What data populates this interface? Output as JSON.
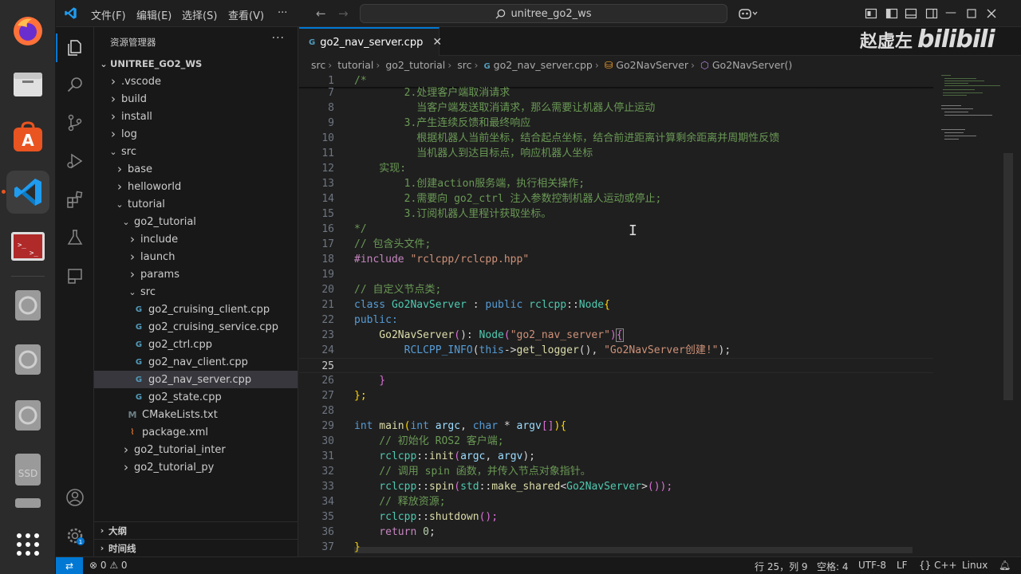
{
  "titlebar": {
    "menus": [
      "文件(F)",
      "编辑(E)",
      "选择(S)",
      "查看(V)",
      "···"
    ],
    "search_text": "unitree_go2_ws"
  },
  "explorer": {
    "title": "资源管理器",
    "root": "UNITREE_GO2_WS",
    "items": [
      {
        "label": ".vscode",
        "depth": 1,
        "kind": "folder-closed"
      },
      {
        "label": "build",
        "depth": 1,
        "kind": "folder-closed"
      },
      {
        "label": "install",
        "depth": 1,
        "kind": "folder-closed"
      },
      {
        "label": "log",
        "depth": 1,
        "kind": "folder-closed"
      },
      {
        "label": "src",
        "depth": 1,
        "kind": "folder-open"
      },
      {
        "label": "base",
        "depth": 2,
        "kind": "folder-closed"
      },
      {
        "label": "helloworld",
        "depth": 2,
        "kind": "folder-closed"
      },
      {
        "label": "tutorial",
        "depth": 2,
        "kind": "folder-open"
      },
      {
        "label": "go2_tutorial",
        "depth": 3,
        "kind": "folder-open"
      },
      {
        "label": "include",
        "depth": 4,
        "kind": "folder-closed"
      },
      {
        "label": "launch",
        "depth": 4,
        "kind": "folder-closed"
      },
      {
        "label": "params",
        "depth": 4,
        "kind": "folder-closed"
      },
      {
        "label": "src",
        "depth": 4,
        "kind": "folder-open"
      },
      {
        "label": "go2_cruising_client.cpp",
        "depth": 5,
        "kind": "cpp"
      },
      {
        "label": "go2_cruising_service.cpp",
        "depth": 5,
        "kind": "cpp"
      },
      {
        "label": "go2_ctrl.cpp",
        "depth": 5,
        "kind": "cpp"
      },
      {
        "label": "go2_nav_client.cpp",
        "depth": 5,
        "kind": "cpp"
      },
      {
        "label": "go2_nav_server.cpp",
        "depth": 5,
        "kind": "cpp",
        "selected": true
      },
      {
        "label": "go2_state.cpp",
        "depth": 5,
        "kind": "cpp"
      },
      {
        "label": "CMakeLists.txt",
        "depth": 4,
        "kind": "cmake"
      },
      {
        "label": "package.xml",
        "depth": 4,
        "kind": "xml"
      },
      {
        "label": "go2_tutorial_inter",
        "depth": 3,
        "kind": "folder-closed"
      },
      {
        "label": "go2_tutorial_py",
        "depth": 3,
        "kind": "folder-closed"
      }
    ],
    "outline": "大纲",
    "timeline": "时间线"
  },
  "editor": {
    "tab_label": "go2_nav_server.cpp",
    "breadcrumbs": [
      "src",
      "tutorial",
      "go2_tutorial",
      "src",
      "go2_nav_server.cpp",
      "Go2NavServer",
      "Go2NavServer()"
    ],
    "cursor_line": 25
  },
  "code": {
    "l1": "1",
    "t1": "/*",
    "l7": "7",
    "t7": "        2.处理客户端取消请求",
    "l8": "8",
    "t8": "          当客户端发送取消请求，那么需要让机器人停止运动",
    "l9": "9",
    "t9": "        3.产生连续反馈和最终响应",
    "l10": "10",
    "t10": "          根据机器人当前坐标，结合起点坐标，结合前进距离计算剩余距离并周期性反馈",
    "l11": "11",
    "t11": "          当机器人到达目标点，响应机器人坐标",
    "l12": "12",
    "t12": "    实现:",
    "l13": "13",
    "t13": "        1.创建action服务端，执行相关操作;",
    "l14": "14",
    "t14": "        2.需要向 go2_ctrl 注入参数控制机器人运动或停止;",
    "l15": "15",
    "t15": "        3.订阅机器人里程计获取坐标。",
    "l16": "16",
    "t16": "*/",
    "l17": "17",
    "t17": "// 包含头文件;",
    "l18": "18",
    "t18a": "#include",
    "t18b": " \"rclcpp/rclcpp.hpp\"",
    "l19": "19",
    "l20": "20",
    "t20": "// 自定义节点类;",
    "l21": "21",
    "t21a": "class",
    "t21b": " Go2NavServer",
    "t21c": " : ",
    "t21d": "public",
    "t21e": " rclcpp",
    "t21f": "::",
    "t21g": "Node",
    "t21h": "{",
    "l22": "22",
    "t22": "public:",
    "l23": "23",
    "t23a": "    Go2NavServer",
    "t23b": "(",
    "t23c": "): ",
    "t23d": "Node",
    "t23e": "(",
    "t23f": "\"go2_nav_server\"",
    "t23g": ")",
    "t23h": "{",
    "l24": "24",
    "t24a": "        RCLCPP_INFO",
    "t24b": "(",
    "t24c": "this",
    "t24d": "->",
    "t24e": "get_logger",
    "t24f": "(), ",
    "t24g": "\"Go2NavServer创建!\"",
    "t24h": ");",
    "l25": "25",
    "l26": "26",
    "t26": "    }",
    "l27": "27",
    "t27": "};",
    "l28": "28",
    "l29": "29",
    "t29a": "int",
    "t29b": " main",
    "t29c": "(",
    "t29d": "int",
    "t29e": " argc",
    "t29f": ", ",
    "t29g": "char",
    "t29h": " * ",
    "t29i": "argv",
    "t29j": "[]",
    "t29k": "){",
    "l30": "30",
    "t30": "    // 初始化 ROS2 客户端;",
    "l31": "31",
    "t31a": "    rclcpp",
    "t31b": "::",
    "t31c": "init",
    "t31d": "(",
    "t31e": "argc",
    "t31f": ", ",
    "t31g": "argv",
    "t31h": ");",
    "l32": "32",
    "t32": "    // 调用 spin 函数，并传入节点对象指针。",
    "l33": "33",
    "t33a": "    rclcpp",
    "t33b": "::",
    "t33c": "spin",
    "t33d": "(",
    "t33e": "std",
    "t33f": "::",
    "t33g": "make_shared",
    "t33h": "<",
    "t33i": "Go2NavServer",
    "t33j": ">",
    "t33k": "());",
    "l34": "34",
    "t34": "    // 释放资源;",
    "l35": "35",
    "t35a": "    rclcpp",
    "t35b": "::",
    "t35c": "shutdown",
    "t35d": "();",
    "l36": "36",
    "t36a": "    return",
    "t36b": " 0",
    "t36c": ";",
    "l37": "37",
    "t37": "}"
  },
  "watermark": {
    "name": "赵虚左",
    "logo": "bilibili"
  },
  "status": {
    "problems": "⊗ 0 ⚠ 0",
    "position": "行 25，列 9",
    "spaces": "空格: 4",
    "encoding": "UTF-8",
    "eol": "LF",
    "language": "{} C++",
    "os": "Linux"
  },
  "colors": {
    "accent": "#0078d4",
    "ubuntu_orange": "#e95420"
  }
}
